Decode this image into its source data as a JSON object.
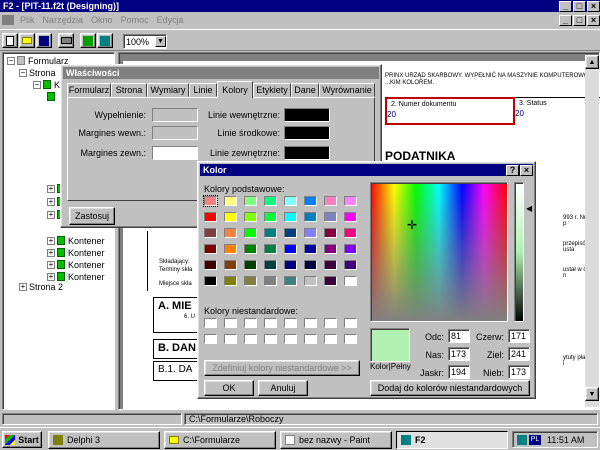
{
  "app": {
    "title": "F2 - [PIT-11.f2t (Designing)]",
    "menu": [
      "Plik",
      "Narzędzia",
      "Okno",
      "Pomoc",
      "Edycja"
    ],
    "zoom": "100%"
  },
  "tree": {
    "root": "Formularz",
    "strona": "Strona",
    "strona2": "Strona 2",
    "kontener": "Kontener"
  },
  "document": {
    "instruction": "PRINX URZĄD SKARBOWY. WYPEŁNIĆ NA MASZYNIE KOMPUTEROWO ...KIM KOLOREM.",
    "field2_label": "2. Numer dokumentu",
    "field2_value": "20",
    "field3_label": "3. Status",
    "field3_value": "20",
    "section_podatnika": "PODATNIKA",
    "sidenote1": "993 r. Nr 90, p",
    "sidenote2": "przepisów usta",
    "sidenote3": "ustał w ciągu n",
    "sidenote4": "ytuty płatnika i",
    "skladajacy": "Składający:",
    "terminy": "Terminy skła",
    "miejsce": "Miejsce skła",
    "section_a": "A. MIE",
    "section_a_sub": "6. U",
    "section_b": "B. DAN",
    "section_b1": "B.1. DA"
  },
  "properties": {
    "title": "Właściwości",
    "tabs": [
      "Formularz",
      "Strona",
      "Wymiary",
      "Linie",
      "Kolory",
      "Etykiety",
      "Dane",
      "Wyrównanie"
    ],
    "active_tab": "Kolory",
    "labels": {
      "wypelnienie": "Wypełnienie:",
      "margines_wewn": "Margines wewn.:",
      "margines_zewn": "Margines zewn.:",
      "linie_wewn": "Linie wewnętrzne:",
      "linie_srodk": "Linie środkowe:",
      "linie_zewn": "Linie zewnętrzne:"
    },
    "apply_button": "Zastosuj"
  },
  "color_dialog": {
    "title": "Kolor",
    "basic_label": "Kolory podstawowe:",
    "custom_label": "Kolory niestandardowe:",
    "define_button": "Zdefiniuj kolory niestandardowe >>",
    "ok": "OK",
    "cancel": "Anuluj",
    "preview_label": "Kolor|Pełny",
    "add_button": "Dodaj do kolorów niestandardowych",
    "fields": {
      "odc_label": "Odc:",
      "odc": "81",
      "nas_label": "Nas:",
      "nas": "173",
      "jaskr_label": "Jaskr:",
      "jaskr": "194",
      "czerw_label": "Czerw:",
      "czerw": "171",
      "ziel_label": "Ziel:",
      "ziel": "241",
      "nieb_label": "Nieb:",
      "nieb": "173"
    },
    "basic_colors": [
      "#ff8080",
      "#ffff80",
      "#80ff80",
      "#00ff80",
      "#80ffff",
      "#0080ff",
      "#ff80c0",
      "#ff80ff",
      "#ff0000",
      "#ffff00",
      "#80ff00",
      "#00ff40",
      "#00ffff",
      "#0080c0",
      "#8080c0",
      "#ff00ff",
      "#804040",
      "#ff8040",
      "#00ff00",
      "#008080",
      "#004080",
      "#8080ff",
      "#800040",
      "#ff0080",
      "#800000",
      "#ff8000",
      "#008000",
      "#008040",
      "#0000ff",
      "#0000a0",
      "#800080",
      "#8000ff",
      "#400000",
      "#804000",
      "#004000",
      "#004040",
      "#000080",
      "#000040",
      "#400040",
      "#400080",
      "#000000",
      "#808000",
      "#808040",
      "#808080",
      "#408080",
      "#c0c0c0",
      "#400040",
      "#ffffff"
    ],
    "selected_color": "#b0f0b0"
  },
  "statusbar": {
    "path": "C:\\Formularze\\Roboczy"
  },
  "taskbar": {
    "start": "Start",
    "tasks": [
      "Delphi 3",
      "C:\\Formularze",
      "bez nazwy - Paint",
      "F2"
    ],
    "clock": "11:51 AM"
  }
}
